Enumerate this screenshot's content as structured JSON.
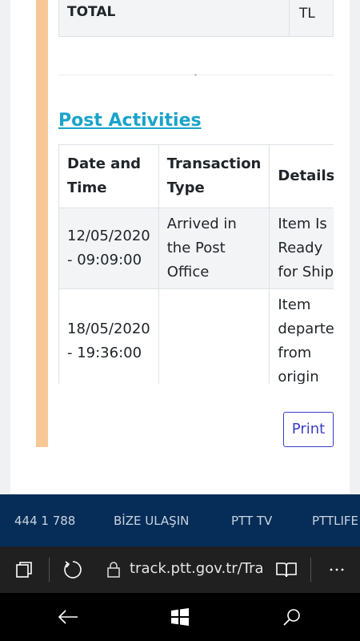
{
  "total": {
    "label": "TOTAL",
    "value": "TL"
  },
  "post_activities": {
    "title": "Post Activities",
    "headers": [
      "Date and Time",
      "Transaction Type",
      "Details"
    ],
    "rows": [
      {
        "date": "12/05/2020 - 09:09:00",
        "type": "Arrived in the Post Office",
        "details": "Item Is Ready for Ship"
      },
      {
        "date": "18/05/2020 - 19:36:00",
        "type": "",
        "details": "Item departed from origin"
      }
    ]
  },
  "print_label": "Print",
  "footer": {
    "links": [
      "444 1 788",
      "BİZE ULAŞIN",
      "PTT TV",
      "PTTLIFE"
    ]
  },
  "browser": {
    "url": "track.ptt.gov.tr/Track"
  },
  "colors": {
    "accent_bar": "#f7c896",
    "link": "#1aa3c9",
    "footer_bg": "#062d58",
    "print_border": "#3b3fc4"
  },
  "icons": [
    "tabs-icon",
    "refresh-icon",
    "lock-icon",
    "reading-view-icon",
    "more-icon",
    "back-icon",
    "windows-icon",
    "search-icon"
  ]
}
